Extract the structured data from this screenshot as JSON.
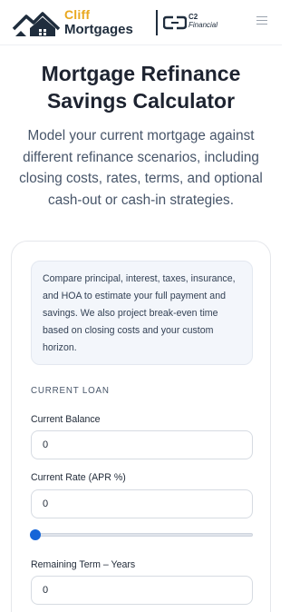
{
  "header": {
    "brand_top": "Cliff",
    "brand_bottom": "Mortgages",
    "partner_top": "C2",
    "partner_bottom": "Financial"
  },
  "hero": {
    "title": "Mortgage Refinance Savings Calculator",
    "subtitle": "Model your current mortgage against different refinance scenarios, including closing costs, rates, terms, and optional cash-out or cash-in strategies."
  },
  "card": {
    "info": "Compare principal, interest, taxes, insurance, and HOA to estimate your full payment and savings. We also project break-even time based on closing costs and your custom horizon.",
    "section_label": "CURRENT LOAN",
    "fields": [
      {
        "label": "Current Balance",
        "value": "0"
      },
      {
        "label": "Current Rate (APR %)",
        "value": "0"
      },
      {
        "label": "Remaining Term – Years",
        "value": "0"
      }
    ],
    "rate_slider_level": 0
  },
  "colors": {
    "accent": "#1565d8",
    "brand_gold": "#e9a820",
    "brand_navy": "#1f2d3d"
  },
  "icons": {
    "logo": "house-roof-icon",
    "partner": "c2-mark-icon",
    "menu": "hamburger-menu-icon"
  }
}
